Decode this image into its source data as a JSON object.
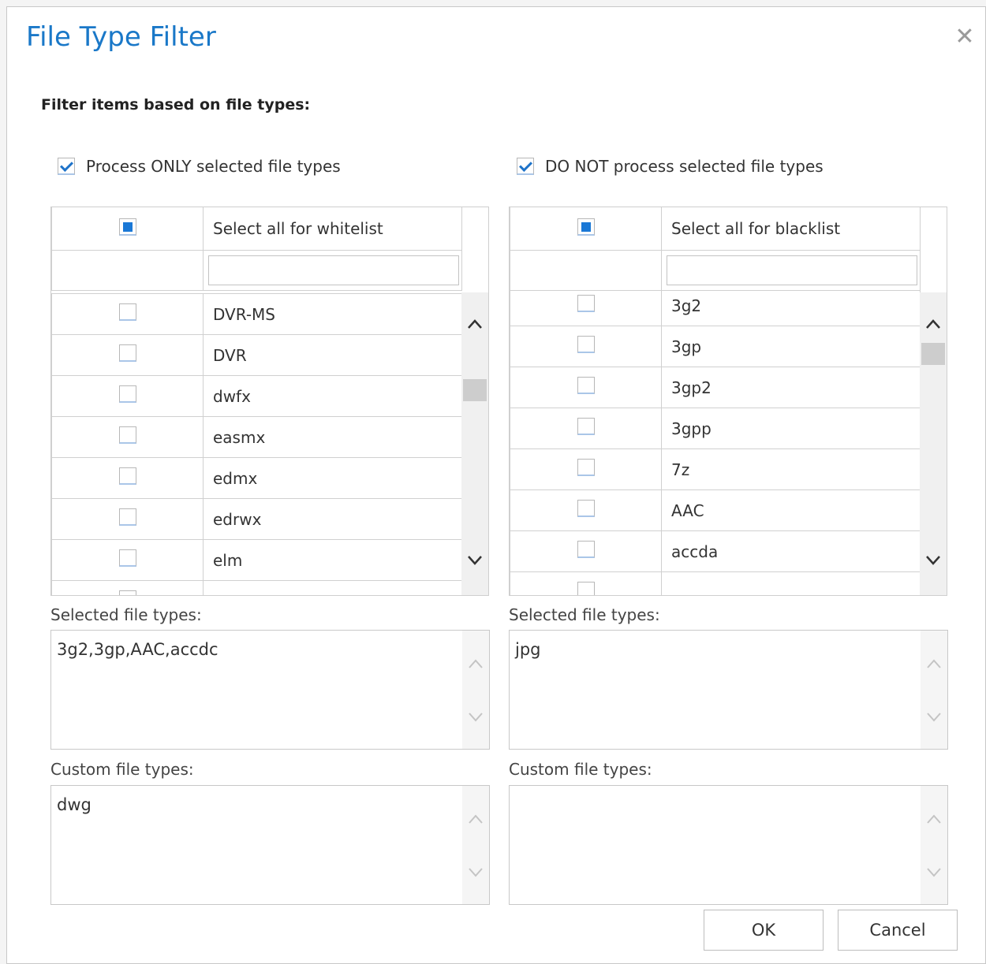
{
  "dialog": {
    "title": "File Type Filter",
    "close_glyph": "✕",
    "section_label": "Filter items based on file types:"
  },
  "whitelist": {
    "toggle_label": "Process ONLY selected file types",
    "toggle_checked": true,
    "select_all_label": "Select all for whitelist",
    "filter_value": "",
    "items": [
      "DVR-MS",
      "DVR",
      "dwfx",
      "easmx",
      "edmx",
      "edrwx",
      "elm"
    ],
    "selected_label": "Selected file types:",
    "selected_value": "3g2,3gp,AAC,accdc",
    "custom_label": "Custom file types:",
    "custom_value": "dwg"
  },
  "blacklist": {
    "toggle_label": "DO NOT process selected file types",
    "toggle_checked": true,
    "select_all_label": "Select all for blacklist",
    "filter_value": "",
    "items": [
      "3g2",
      "3gp",
      "3gp2",
      "3gpp",
      "7z",
      "AAC",
      "accda"
    ],
    "selected_label": "Selected file types:",
    "selected_value": "jpg",
    "custom_label": "Custom file types:",
    "custom_value": ""
  },
  "icons": {
    "up": "chevron-up-icon",
    "down": "chevron-down-icon",
    "up_glyph": "⌃",
    "down_glyph": "⌄"
  },
  "buttons": {
    "ok": "OK",
    "cancel": "Cancel"
  },
  "colors": {
    "title": "#1a78c8",
    "check": "#1e73c9"
  }
}
